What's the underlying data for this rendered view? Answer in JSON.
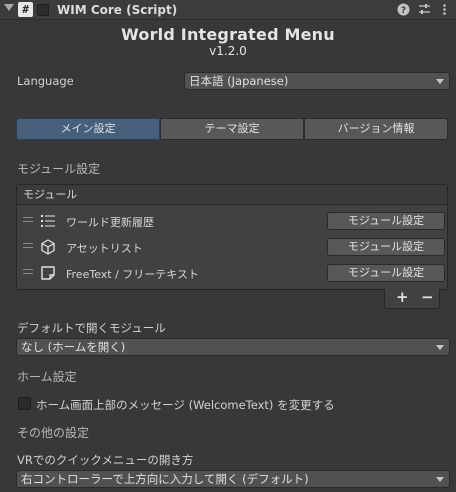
{
  "header": {
    "component_title": "WIM Core (Script)",
    "script_icon": "#",
    "icons": [
      "help-icon",
      "settings-sliders-icon",
      "more-options-icon"
    ]
  },
  "title": {
    "main": "World Integrated Menu",
    "version": "v1.2.0"
  },
  "language": {
    "label": "Language",
    "value": "日本語 (Japanese)"
  },
  "tabs": [
    {
      "label": "メイン設定",
      "active": true
    },
    {
      "label": "テーマ設定",
      "active": false
    },
    {
      "label": "バージョン情報",
      "active": false
    }
  ],
  "modules_section": {
    "heading": "モジュール設定",
    "list_header": "モジュール",
    "items": [
      {
        "icon": "list-icon",
        "label": "ワールド更新履歴",
        "button": "モジュール設定"
      },
      {
        "icon": "cube-icon",
        "label": "アセットリスト",
        "button": "モジュール設定"
      },
      {
        "icon": "sticky-note-icon",
        "label": "FreeText / フリーテキスト",
        "button": "モジュール設定"
      }
    ],
    "add_label": "+",
    "remove_label": "−"
  },
  "default_module": {
    "label": "デフォルトで開くモジュール",
    "value": "なし (ホームを開く)"
  },
  "home": {
    "heading": "ホーム設定",
    "checkbox_label": "ホーム画面上部のメッセージ (WelcomeText) を変更する",
    "checked": false
  },
  "other": {
    "heading": "その他の設定",
    "vr_label": "VRでのクイックメニューの開き方",
    "vr_value": "右コントローラーで上方向に入力して開く (デフォルト)"
  },
  "colors": {
    "background": "#383838",
    "active_tab": "#46607c",
    "button": "#585858"
  }
}
